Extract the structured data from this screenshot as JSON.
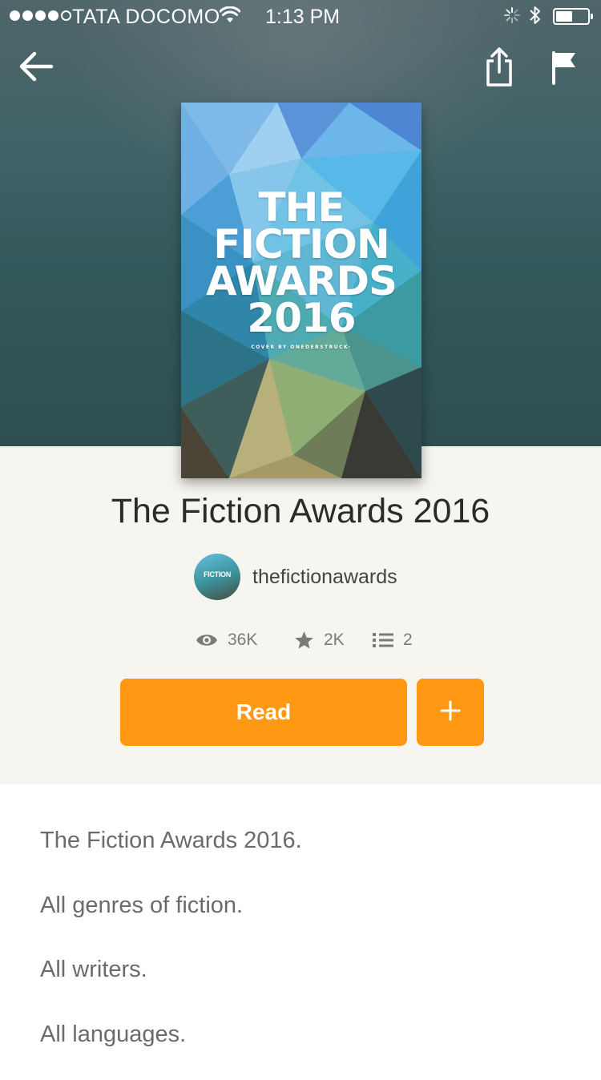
{
  "status_bar": {
    "carrier": "TATA DOCOMO",
    "time": "1:13 PM"
  },
  "nav": {
    "back_icon": "arrow-left-icon",
    "share_icon": "share-icon",
    "flag_icon": "flag-icon"
  },
  "cover": {
    "lines": [
      "THE",
      "FICTION",
      "AWARDS",
      "2016"
    ],
    "credit": "COVER BY ONEDERSTRUCK-"
  },
  "book": {
    "title": "The Fiction Awards 2016",
    "author": "thefictionawards",
    "avatar_text": "FICTION"
  },
  "stats": {
    "views": "36K",
    "votes": "2K",
    "parts": "2"
  },
  "actions": {
    "read_label": "Read",
    "add_label": "+"
  },
  "description": [
    "The Fiction Awards 2016.",
    "All genres of fiction.",
    "All writers.",
    "All languages."
  ],
  "colors": {
    "accent": "#ff9812",
    "info_background": "#f7f5f0",
    "hero_background": "#3f6266"
  }
}
